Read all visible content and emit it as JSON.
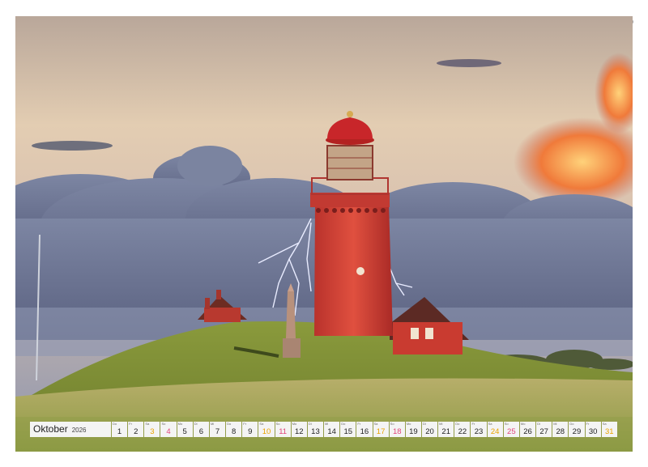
{
  "calendar": {
    "month": "Oktober",
    "year": "2026",
    "weekend_colors": {
      "saturday": "#e8a200",
      "sunday": "#e0457b"
    },
    "days": [
      {
        "wd": "Do",
        "num": "1",
        "type": "weekday"
      },
      {
        "wd": "Fr",
        "num": "2",
        "type": "weekday"
      },
      {
        "wd": "Sa",
        "num": "3",
        "type": "sat"
      },
      {
        "wd": "So",
        "num": "4",
        "type": "sun"
      },
      {
        "wd": "Mo",
        "num": "5",
        "type": "weekday"
      },
      {
        "wd": "Di",
        "num": "6",
        "type": "weekday"
      },
      {
        "wd": "Mi",
        "num": "7",
        "type": "weekday"
      },
      {
        "wd": "Do",
        "num": "8",
        "type": "weekday"
      },
      {
        "wd": "Fr",
        "num": "9",
        "type": "weekday"
      },
      {
        "wd": "Sa",
        "num": "10",
        "type": "sat"
      },
      {
        "wd": "So",
        "num": "11",
        "type": "sun"
      },
      {
        "wd": "Mo",
        "num": "12",
        "type": "weekday"
      },
      {
        "wd": "Di",
        "num": "13",
        "type": "weekday"
      },
      {
        "wd": "Mi",
        "num": "14",
        "type": "weekday"
      },
      {
        "wd": "Do",
        "num": "15",
        "type": "weekday"
      },
      {
        "wd": "Fr",
        "num": "16",
        "type": "weekday"
      },
      {
        "wd": "Sa",
        "num": "17",
        "type": "sat"
      },
      {
        "wd": "So",
        "num": "18",
        "type": "sun"
      },
      {
        "wd": "Mo",
        "num": "19",
        "type": "weekday"
      },
      {
        "wd": "Di",
        "num": "20",
        "type": "weekday"
      },
      {
        "wd": "Mi",
        "num": "21",
        "type": "weekday"
      },
      {
        "wd": "Do",
        "num": "22",
        "type": "weekday"
      },
      {
        "wd": "Fr",
        "num": "23",
        "type": "weekday"
      },
      {
        "wd": "Sa",
        "num": "24",
        "type": "sat"
      },
      {
        "wd": "So",
        "num": "25",
        "type": "sun"
      },
      {
        "wd": "Mo",
        "num": "26",
        "type": "weekday"
      },
      {
        "wd": "Di",
        "num": "27",
        "type": "weekday"
      },
      {
        "wd": "Mi",
        "num": "28",
        "type": "weekday"
      },
      {
        "wd": "Do",
        "num": "29",
        "type": "weekday"
      },
      {
        "wd": "Fr",
        "num": "30",
        "type": "weekday"
      },
      {
        "wd": "Sa",
        "num": "31",
        "type": "sat"
      }
    ]
  },
  "photo_colors": {
    "tower": "#d8443a",
    "dome": "#c8262a",
    "grass": "#8a9a3c",
    "sky_top": "#c9b7a0",
    "storm_cloud": "#6d7590",
    "sunset_cloud": "#f07a3a"
  }
}
